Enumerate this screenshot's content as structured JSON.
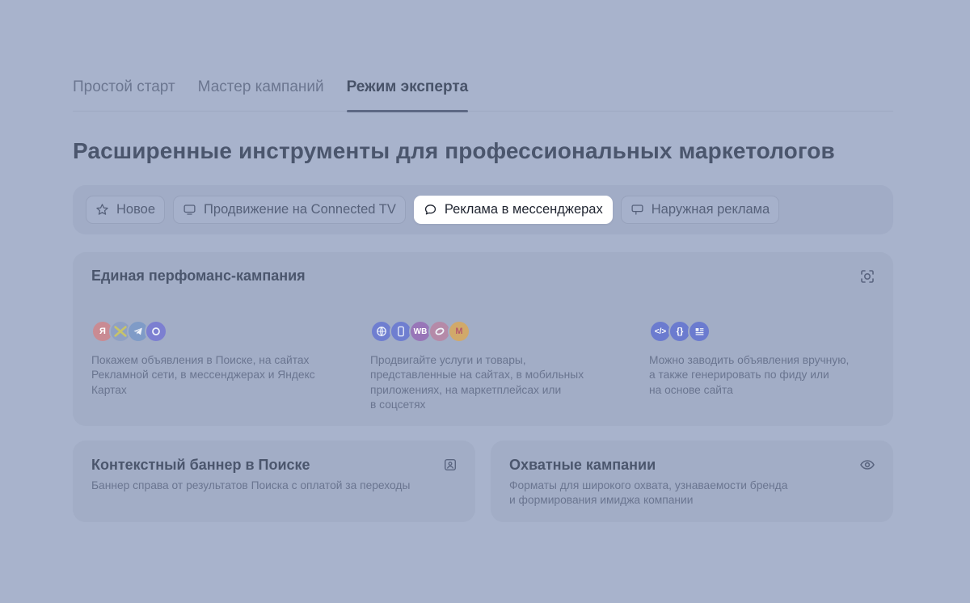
{
  "tabs": [
    {
      "label": "Простой старт"
    },
    {
      "label": "Мастер кампаний"
    },
    {
      "label": "Режим эксперта"
    }
  ],
  "active_tab": "Режим эксперта",
  "page_title": "Расширенные инструменты для профессиональных маркетологов",
  "chips": [
    {
      "label": "Новое",
      "icon": "star-icon"
    },
    {
      "label": "Продвижение на Connected TV",
      "icon": "monitor-icon"
    },
    {
      "label": "Реклама в мессенджерах",
      "icon": "chat-bubble-icon"
    },
    {
      "label": "Наружная реклама",
      "icon": "billboard-icon"
    }
  ],
  "active_chip": "Реклама в мессенджерах",
  "performance_card": {
    "title": "Единая перфоманс-кампания",
    "icon": "target-scan-icon",
    "columns": [
      {
        "logos": [
          "Я",
          "",
          "",
          ""
        ],
        "desc_lines": [
          "Покажем объявления в Поиске, на сайтах",
          "Рекламной сети, в мессенджерах и Яндекс",
          "Картах"
        ]
      },
      {
        "logos": [
          "",
          "",
          "WB",
          "",
          "M"
        ],
        "desc_lines": [
          "Продвигайте услуги и товары,",
          "представленные на сайтах, в мобильных",
          "приложениях, на маркетплейсах или",
          "в соцсетях"
        ]
      },
      {
        "logos": [
          "</>",
          "{}",
          ""
        ],
        "desc_lines": [
          "Можно заводить объявления вручную,",
          "а также генерировать по фиду или",
          "на основе сайта"
        ]
      }
    ]
  },
  "banner_card": {
    "title": "Контекстный баннер в Поиске",
    "desc_lines": [
      "Баннер справа от результатов Поиска с оплатой за переходы"
    ],
    "icon": "image-frame-icon"
  },
  "reach_card": {
    "title": "Охватные кампании",
    "desc_lines": [
      "Форматы для широкого охвата, узнаваемости бренда",
      "и формирования имиджа компании"
    ],
    "icon": "eye-icon"
  },
  "colors": {
    "background": "#a8b3cc",
    "card": "#a2adc6",
    "active_chip": "#ffffff"
  }
}
